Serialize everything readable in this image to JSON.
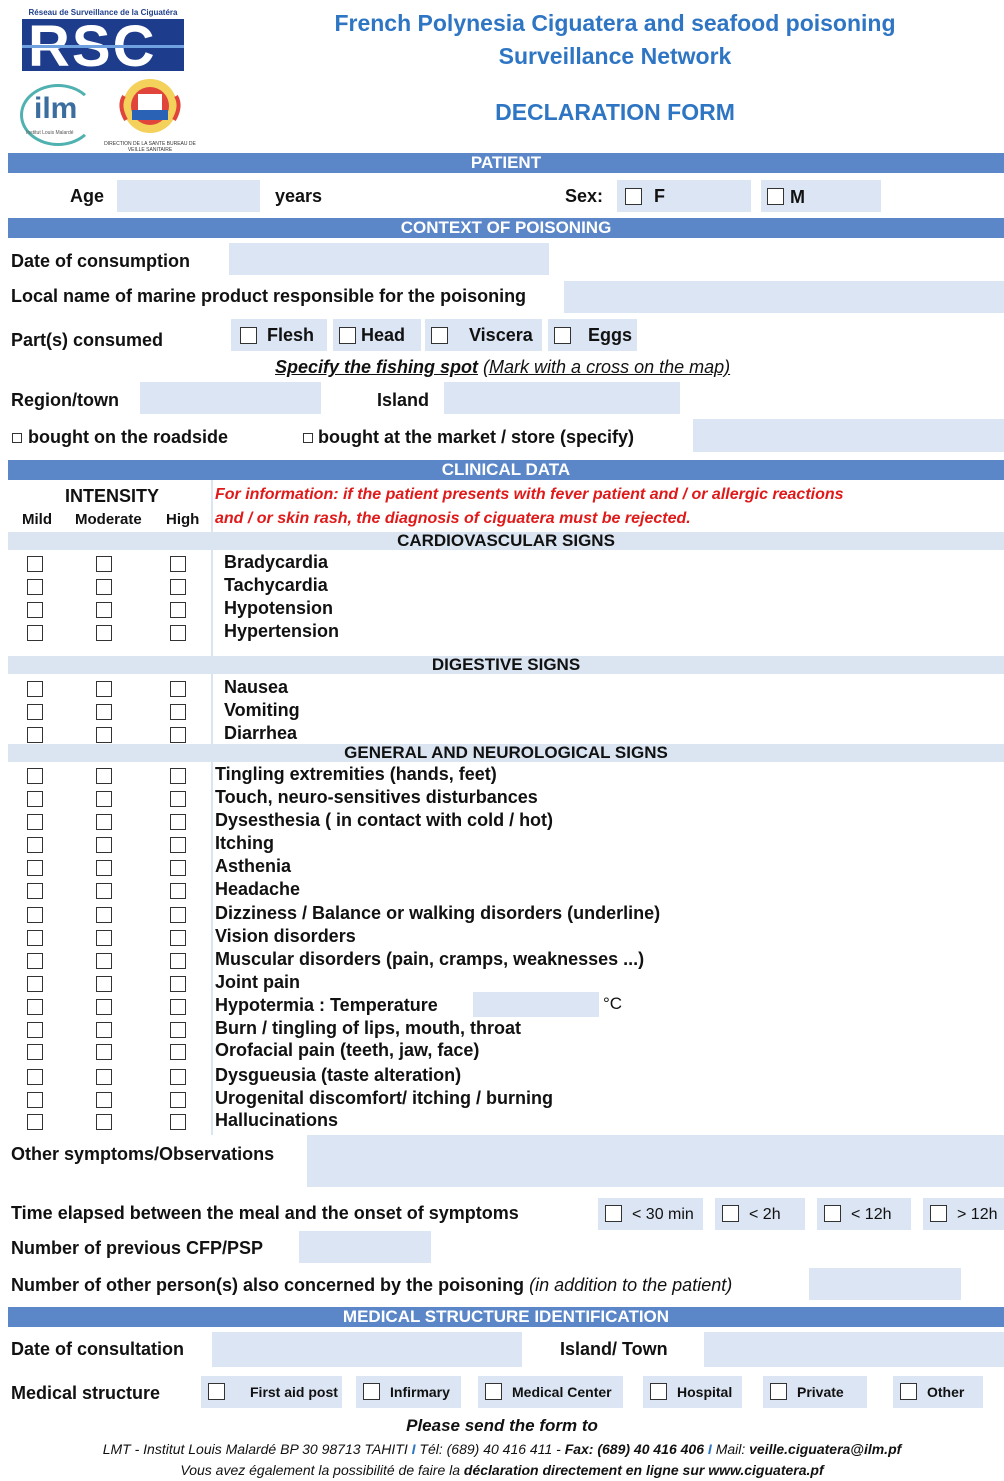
{
  "header": {
    "logo_rsc_caption": "Réseau de Surveillance de la Ciguatéra",
    "logo_rsc_text": "RSC",
    "logo_ilm_text": "ilm",
    "logo_ilm_caption": "Institut Louis Malardé",
    "logo_sante_caption": "DIRECTION DE LA SANTE BUREAU DE VEILLE SANITAIRE",
    "title_line1": "French Polynesia Ciguatera and seafood poisoning",
    "title_line2": "Surveillance Network",
    "form_title": "DECLARATION FORM"
  },
  "patient": {
    "section": "PATIENT",
    "age_label": "Age",
    "years_label": "years",
    "sex_label": "Sex:",
    "sex_f": "F",
    "sex_m": "M"
  },
  "context": {
    "section": "CONTEXT OF POISONING",
    "date_label": "Date of consumption",
    "local_name_label": "Local name of marine product responsible for the poisoning",
    "parts_label": "Part(s) consumed",
    "parts": [
      "Flesh",
      "Head",
      "Viscera",
      "Eggs"
    ],
    "fishing_spot_label": "Specify the fishing spot",
    "fishing_spot_hint": "(Mark with a cross on the map)",
    "region_label": "Region/town",
    "island_label": "Island",
    "roadside_label": "bought on the roadside",
    "market_label": "bought at the market / store (specify)"
  },
  "clinical": {
    "section": "CLINICAL DATA",
    "intensity_label": "INTENSITY",
    "levels": [
      "Mild",
      "Moderate",
      "High"
    ],
    "info_line1": "For information: if the patient presents with fever patient and / or allergic reactions",
    "info_line2": "and / or skin rash, the diagnosis of ciguatera must be rejected.",
    "cardio_title": "CARDIOVASCULAR SIGNS",
    "cardio_signs": [
      "Bradycardia",
      "Tachycardia",
      "Hypotension",
      "Hypertension"
    ],
    "digestive_title": "DIGESTIVE SIGNS",
    "digestive_signs": [
      "Nausea",
      "Vomiting",
      "Diarrhea"
    ],
    "general_title": "GENERAL AND NEUROLOGICAL SIGNS",
    "general_signs": [
      "Tingling extremities (hands, feet)",
      "Touch, neuro-sensitives disturbances",
      "Dysesthesia ( in contact with cold / hot)",
      "Itching",
      "Asthenia",
      "Headache",
      "Dizziness / Balance or walking  disorders (underline)",
      "Vision disorders",
      "Muscular disorders (pain, cramps, weaknesses ...)",
      "Joint pain",
      "Hypotermia : Temperature",
      "Burn / tingling of lips, mouth, throat",
      "Orofacial pain (teeth, jaw, face)",
      "Dysgueusia (taste alteration)",
      "Urogenital discomfort/ itching / burning",
      "Hallucinations"
    ],
    "temp_unit": "°C",
    "other_symptoms_label": "Other symptoms/Observations",
    "time_label": "Time elapsed between the meal and the onset of symptoms",
    "time_options": [
      "< 30 min",
      "< 2h",
      "< 12h",
      "> 12h"
    ],
    "previous_label": "Number of previous CFP/PSP",
    "others_label": "Number of other person(s) also concerned by the poisoning",
    "others_hint": "(in addition to the patient)"
  },
  "medical": {
    "section": "MEDICAL STRUCTURE IDENTIFICATION",
    "date_label": "Date of consultation",
    "island_town_label": "Island/ Town",
    "structure_label": "Medical structure",
    "structures": [
      "First aid post",
      "Infirmary",
      "Medical Center",
      "Hospital",
      "Private",
      "Other"
    ]
  },
  "footer": {
    "send_label": "Please send the form to",
    "address_pre": "LMT - Institut Louis Malardé BP 30 98713 TAHITI",
    "tel_label": "Tél: (689) 40 416 411 -",
    "fax_label": "Fax: (689) 40 416 406",
    "mail_pre": "Mail:",
    "mail": "veille.ciguatera@ilm.pf",
    "sep": "I",
    "online_pre": "Vous avez également la possibilité de faire la",
    "online_bold": "déclaration directement en ligne sur www.ciguatera.pf"
  },
  "colors": {
    "bar": "#5b87c9",
    "field": "#dbe5f3",
    "title": "#2e75c4",
    "warning": "#e01a1a"
  }
}
